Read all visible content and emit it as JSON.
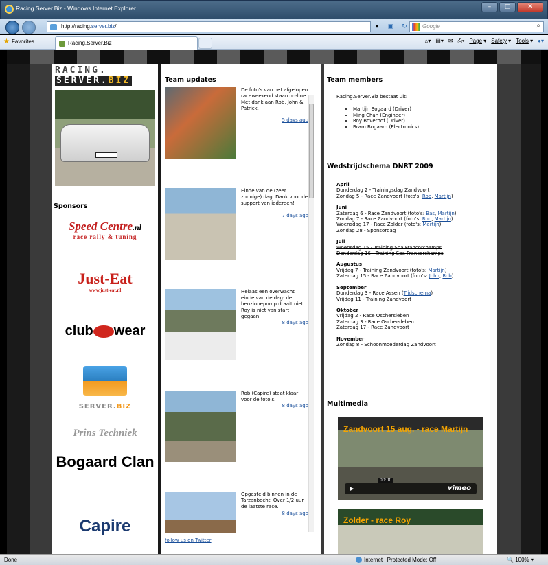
{
  "browser": {
    "window_title": "Racing.Server.Biz - Windows Internet Explorer",
    "address_prefix": "http://racing.",
    "address_domain": "server.biz",
    "address_suffix": "/",
    "search_placeholder": "Google",
    "favorites_label": "Favorites",
    "tab_title": "Racing.Server.Biz",
    "commands": [
      "Page",
      "Safety",
      "Tools"
    ],
    "status_left": "Done",
    "status_zone": "Internet | Protected Mode: Off",
    "zoom": "100%"
  },
  "logo": {
    "line1": "RACING.",
    "line2a": "SERVER.",
    "line2b": "BIZ"
  },
  "sponsors_heading": "Sponsors",
  "sponsors": {
    "s1_main": "Speed Centre",
    "s1_nl": ".nl",
    "s1_sub": "race rally & tuning",
    "s2_main": "Just-Eat",
    "s2_sub": "www.just-eat.nl",
    "s3_a": "club",
    "s3_b": "wear",
    "s4_a": "SERVER.",
    "s4_b": "BIZ",
    "s5": "Prins Techniek",
    "s6": "Bogaard Clan",
    "s7": "Capire"
  },
  "updates": {
    "heading": "Team updates",
    "items": [
      {
        "text": "De foto's van het afgelopen raceweekend staan on-line. Met dank aan Rob, John & Patrick.",
        "date": "5 days ago"
      },
      {
        "text": "Einde van de (zeer zonnige) dag. Dank voor de support van iedereen!",
        "date": "7 days ago"
      },
      {
        "text": "Helaas een overwacht einde van de dag: de benzinnepomp draait niet. Roy is niet van start gegaan.",
        "date": "8 days ago"
      },
      {
        "text": "Rob (Capire) staat klaar voor de foto's.",
        "date": "8 days ago"
      },
      {
        "text": "Opgesteld binnen in de Tarzanbocht. Over 1/2 uur de laatste race.",
        "date": "8 days ago"
      }
    ],
    "follow": "follow us on Twitter"
  },
  "members": {
    "heading": "Team members",
    "intro": "Racing.Server.Biz bestaat uit:",
    "list": [
      "Martijn Bogaard (Driver)",
      "Ming Chan (Engineer)",
      "Roy Boverhof (Driver)",
      "Bram Bogaard (Electronics)"
    ]
  },
  "schedule": {
    "heading": "Wedstrijdschema DNRT 2009",
    "april": {
      "name": "April",
      "l1": "Donderdag 2 - Trainingsdag Zandvoort",
      "l2": "Zondag 5 - Race Zandvoort (foto's: ",
      "l2a": "Rob",
      "l2b": "Martijn",
      "l2c": ")"
    },
    "juni": {
      "name": "Juni",
      "l1": "Zaterdag 6 - Race Zandvoort (foto's: ",
      "l1a": "Bas",
      "l1b": "Martijn",
      "l1c": ")",
      "l2": "Zondag 7 - Race Zandvoort (foto's: ",
      "l2a": "Rob",
      "l2b": "Martijn",
      "l2c": ")",
      "l3": "Woensdag 17 - Race Zolder (foto's: ",
      "l3a": "Martijn",
      "l3c": ")",
      "l4": "Zondag 28 - Sponsordag"
    },
    "juli": {
      "name": "Juli",
      "l1": "Woensdag 15 - Training Spa Francorchamps",
      "l2": "Donderdag 16 - Training Spa Francorchamps"
    },
    "augustus": {
      "name": "Augustus",
      "l1": "Vrijdag 7 - Training Zandvoort (foto's: ",
      "l1a": "Martijn",
      "l1c": ")",
      "l2": "Zaterdag 15 - Race Zandvoort (foto's: ",
      "l2a": "John",
      "l2b": "Rob",
      "l2c": ")"
    },
    "september": {
      "name": "September",
      "l1": "Donderdag 3 - Race Assen (",
      "l1a": "Tijdschema",
      "l1c": ")",
      "l2": "Vrijdag 11 - Training Zandvoort"
    },
    "oktober": {
      "name": "Oktober",
      "l1": "Vrijdag 2 - Race Oschersleben",
      "l2": "Zaterdag 3 - Race Oschersleben",
      "l3": "Zaterdag 17 - Race Zandvoort"
    },
    "november": {
      "name": "November",
      "l1": "Zondag 8 - Schoonmoederdag Zandvoort"
    }
  },
  "multimedia": {
    "heading": "Multimedia",
    "video1_title": "Zandvoort 15 aug. - race Martijn",
    "video1_time": "00:00",
    "video2_title": "Zolder - race Roy",
    "vimeo": "vimeo"
  }
}
